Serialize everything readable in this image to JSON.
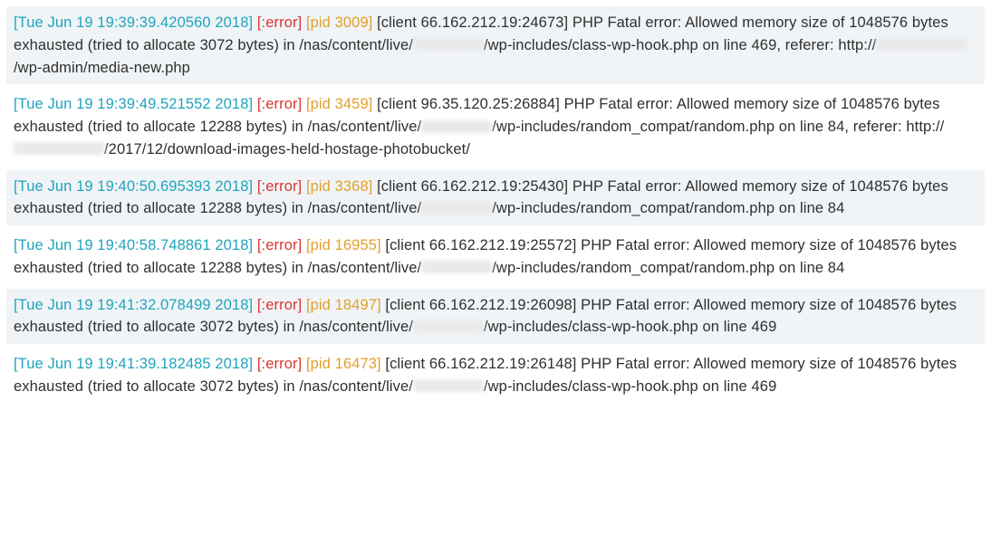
{
  "log_entries": [
    {
      "timestamp": "[Tue Jun 19 19:39:39.420560 2018]",
      "level": "[:error]",
      "pid": "[pid 3009]",
      "client": "[client 66.162.212.19:24673]",
      "msg_a": "PHP Fatal error: Allowed memory size of 1048576 bytes exhausted (tried to allocate 3072 bytes) in /nas/content/live/",
      "redact_a_class": "r-short",
      "msg_b": "/wp-includes/class-wp-hook.php on line 469, referer: http://",
      "redact_b_class": "r-dom",
      "msg_c": "/wp-admin/media-new.php"
    },
    {
      "timestamp": "[Tue Jun 19 19:39:49.521552 2018]",
      "level": "[:error]",
      "pid": "[pid 3459]",
      "client": "[client 96.35.120.25:26884]",
      "msg_a": "PHP Fatal error: Allowed memory size of 1048576 bytes exhausted (tried to allocate 12288 bytes) in /nas/content/live/",
      "redact_a_class": "r-short",
      "msg_b": "/wp-includes/random_compat/random.php on line 84, referer: http://",
      "redact_b_class": "r-dom",
      "msg_c": "/2017/12/download-images-held-hostage-photobucket/"
    },
    {
      "timestamp": "[Tue Jun 19 19:40:50.695393 2018]",
      "level": "[:error]",
      "pid": "[pid 3368]",
      "client": "[client 66.162.212.19:25430]",
      "msg_a": "PHP Fatal error: Allowed memory size of 1048576 bytes exhausted (tried to allocate 12288 bytes) in /nas/content/live/",
      "redact_a_class": "r-short",
      "msg_b": "/wp-includes/random_compat/random.php on line 84",
      "redact_b_class": "",
      "msg_c": ""
    },
    {
      "timestamp": "[Tue Jun 19 19:40:58.748861 2018]",
      "level": "[:error]",
      "pid": "[pid 16955]",
      "client": "[client 66.162.212.19:25572]",
      "msg_a": "PHP Fatal error: Allowed memory size of 1048576 bytes exhausted (tried to allocate 12288 bytes) in /nas/content/live/",
      "redact_a_class": "r-short",
      "msg_b": "/wp-includes/random_compat/random.php on line 84",
      "redact_b_class": "",
      "msg_c": ""
    },
    {
      "timestamp": "[Tue Jun 19 19:41:32.078499 2018]",
      "level": "[:error]",
      "pid": "[pid 18497]",
      "client": "[client 66.162.212.19:26098]",
      "msg_a": "PHP Fatal error: Allowed memory size of 1048576 bytes exhausted (tried to allocate 3072 bytes) in /nas/content/live/",
      "redact_a_class": "r-short",
      "msg_b": "/wp-includes/class-wp-hook.php on line 469",
      "redact_b_class": "",
      "msg_c": ""
    },
    {
      "timestamp": "[Tue Jun 19 19:41:39.182485 2018]",
      "level": "[:error]",
      "pid": "[pid 16473]",
      "client": "[client 66.162.212.19:26148]",
      "msg_a": "PHP Fatal error: Allowed memory size of 1048576 bytes exhausted (tried to allocate 3072 bytes) in /nas/content/live/",
      "redact_a_class": "r-short",
      "msg_b": "/wp-includes/class-wp-hook.php on line 469",
      "redact_b_class": "",
      "msg_c": ""
    }
  ]
}
